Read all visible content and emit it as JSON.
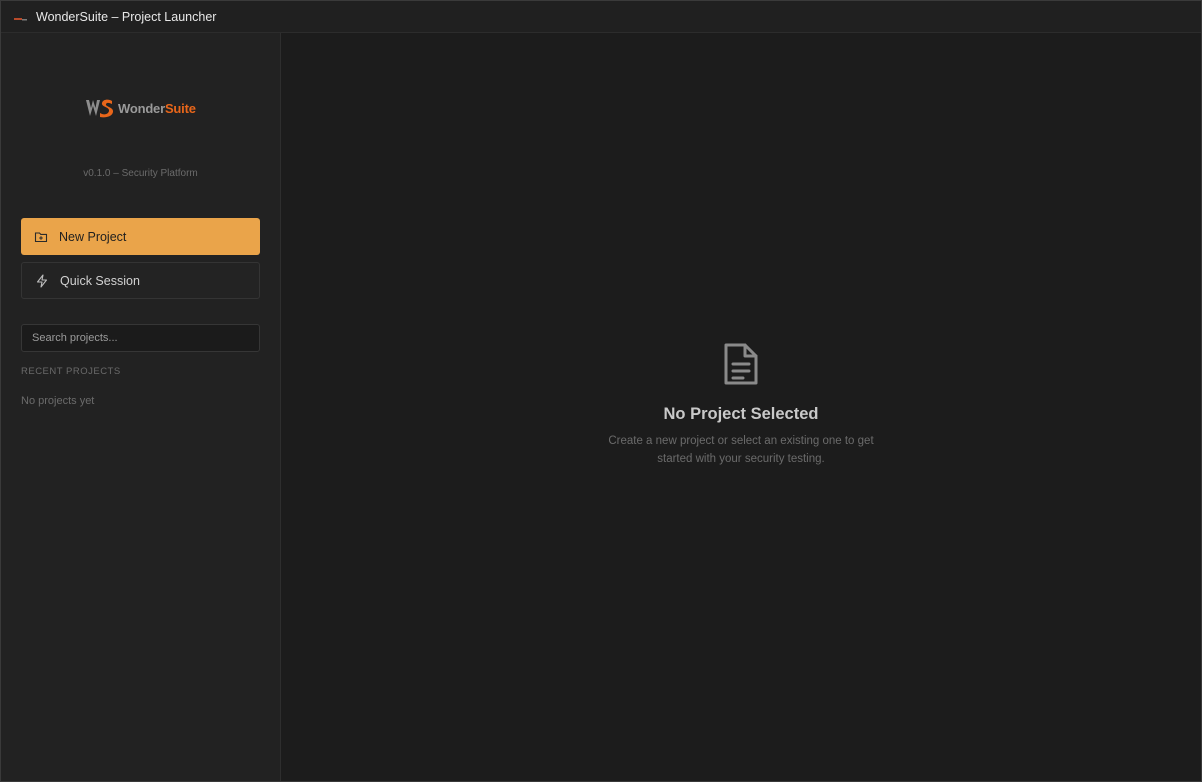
{
  "window": {
    "title": "WonderSuite – Project Launcher"
  },
  "sidebar": {
    "logo": {
      "mark": "WS",
      "word_part1": "Wonder",
      "word_part2": "Suite"
    },
    "version": "v0.1.0 – Security Platform",
    "new_project_label": "New Project",
    "quick_session_label": "Quick Session",
    "search_placeholder": "Search projects...",
    "recent_heading": "RECENT PROJECTS",
    "recent_empty": "No projects yet"
  },
  "main": {
    "empty_title": "No Project Selected",
    "empty_description": "Create a new project or select an existing one to get started with your security testing."
  },
  "colors": {
    "accent": "#eaa44a",
    "brand_orange": "#e8661a",
    "background": "#1c1c1c",
    "sidebar": "#222222"
  },
  "icons": {
    "new_project": "folder-plus-icon",
    "quick_session": "lightning-icon",
    "empty_state": "document-icon"
  }
}
